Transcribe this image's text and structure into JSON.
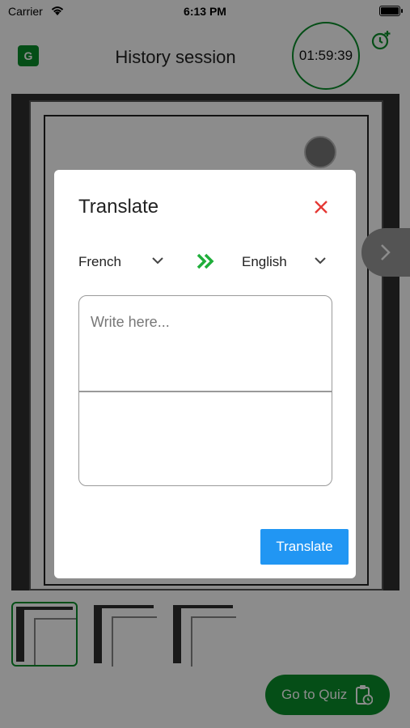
{
  "status_bar": {
    "carrier": "Carrier",
    "time": "6:13 PM"
  },
  "header": {
    "title": "History session",
    "timer": "01:59:39",
    "logo_text": "G",
    "alarm_icon": "alarm-add-icon"
  },
  "quiz_button": {
    "label": "Go to Quiz",
    "icon": "clipboard-clock-icon"
  },
  "modal": {
    "title": "Translate",
    "close_icon": "close-icon",
    "source_language": "French",
    "target_language": "English",
    "input_placeholder": "Write here...",
    "input_value": "",
    "output_value": "",
    "translate_label": "Translate"
  },
  "colors": {
    "accent_green": "#0a8f2a",
    "close_red": "#e53935",
    "button_blue": "#2196f3"
  }
}
